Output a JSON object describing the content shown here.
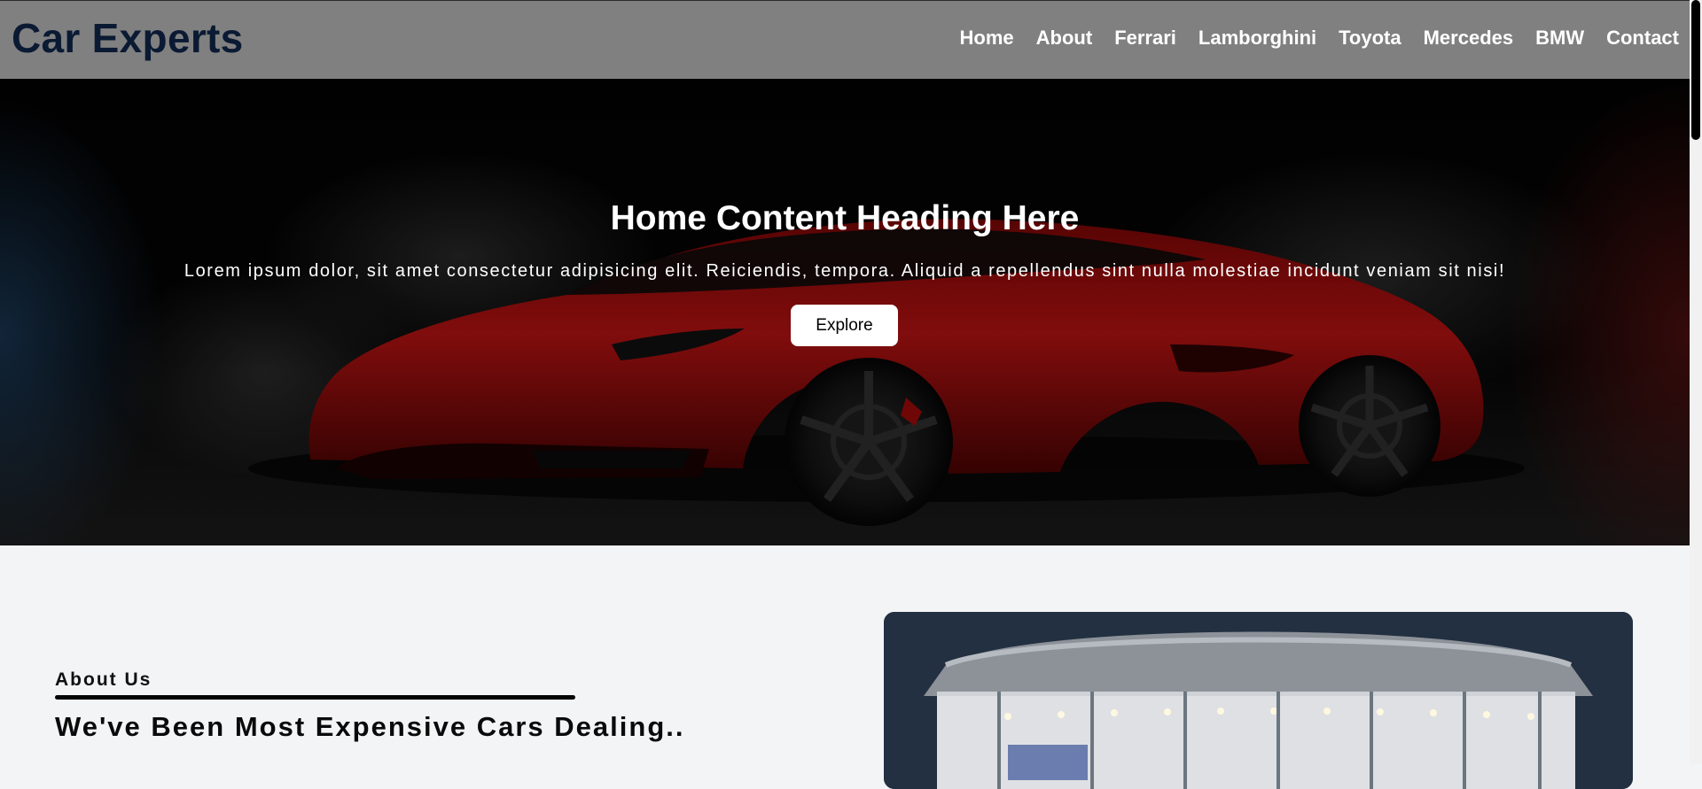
{
  "header": {
    "logo": "Car Experts",
    "nav": [
      "Home",
      "About",
      "Ferrari",
      "Lamborghini",
      "Toyota",
      "Mercedes",
      "BMW",
      "Contact"
    ]
  },
  "hero": {
    "title": "Home Content Heading Here",
    "text": "Lorem ipsum dolor, sit amet consectetur adipisicing elit. Reiciendis, tempora. Aliquid a repellendus sint nulla molestiae incidunt veniam sit nisi!",
    "button": "Explore"
  },
  "about": {
    "eyebrow": "About Us",
    "heading": "We've Been Most Expensive Cars Dealing.."
  },
  "colors": {
    "header_bg": "#808080",
    "logo": "#0b1a33",
    "car_body": "#b01010",
    "page_bg": "#f3f4f6"
  }
}
